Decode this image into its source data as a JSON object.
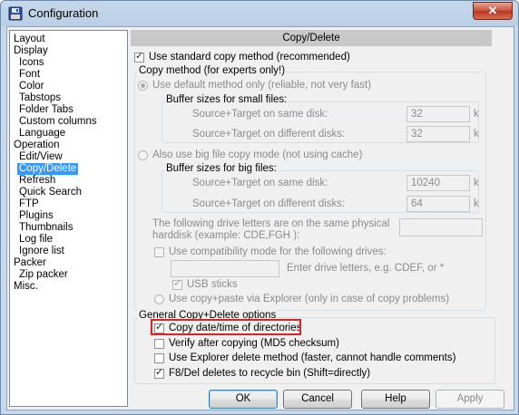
{
  "window": {
    "title": "Configuration",
    "close_glyph": "✕"
  },
  "tree": [
    {
      "label": "Layout",
      "indent": 0
    },
    {
      "label": "Display",
      "indent": 0
    },
    {
      "label": "Icons",
      "indent": 1
    },
    {
      "label": "Font",
      "indent": 1
    },
    {
      "label": "Color",
      "indent": 1
    },
    {
      "label": "Tabstops",
      "indent": 1
    },
    {
      "label": "Folder Tabs",
      "indent": 1
    },
    {
      "label": "Custom columns",
      "indent": 1
    },
    {
      "label": "Language",
      "indent": 1
    },
    {
      "label": "Operation",
      "indent": 0
    },
    {
      "label": "Edit/View",
      "indent": 1
    },
    {
      "label": "Copy/Delete",
      "indent": 1,
      "selected": true
    },
    {
      "label": "Refresh",
      "indent": 1
    },
    {
      "label": "Quick Search",
      "indent": 1
    },
    {
      "label": "FTP",
      "indent": 1
    },
    {
      "label": "Plugins",
      "indent": 1
    },
    {
      "label": "Thumbnails",
      "indent": 1
    },
    {
      "label": "Log file",
      "indent": 1
    },
    {
      "label": "Ignore list",
      "indent": 1
    },
    {
      "label": "Packer",
      "indent": 0
    },
    {
      "label": "Zip packer",
      "indent": 1
    },
    {
      "label": "Misc.",
      "indent": 0
    }
  ],
  "panel": {
    "header": "Copy/Delete",
    "use_standard": "Use standard copy method (recommended)",
    "copy_method_group": "Copy method (for experts only!)",
    "default_method": "Use default method only (reliable, not very fast)",
    "small_buffers": "Buffer sizes for small files:",
    "same_disk": "Source+Target on same disk:",
    "diff_disk": "Source+Target on different disks:",
    "small_same_value": "32",
    "small_diff_value": "32",
    "unit_k": "k",
    "big_file_mode": "Also use big file copy mode (not using cache)",
    "big_buffers": "Buffer sizes for big files:",
    "big_same_value": "10240",
    "big_diff_value": "64",
    "drive_letters_line1": "The following drive letters are on the same physical",
    "drive_letters_line2": "harddisk (example: CDE,FGH ):",
    "compat_mode": "Use compatibility mode for the following drives:",
    "enter_drives": "Enter drive letters, e.g. CDEF, or *",
    "usb_sticks": "USB sticks",
    "copy_paste_explorer": "Use copy+paste via Explorer (only in case of copy problems)",
    "general_group": "General Copy+Delete options",
    "copy_date_time": "Copy date/time of directories",
    "verify": "Verify after copying (MD5 checksum)",
    "explorer_delete": "Use Explorer delete method (faster, cannot handle comments)",
    "f8_del": "F8/Del deletes to recycle bin (Shift=directly)",
    "checkmark": "✓"
  },
  "buttons": {
    "ok": "OK",
    "cancel": "Cancel",
    "help": "Help",
    "apply": "Apply"
  },
  "colors": {
    "selection": "#3399ff",
    "highlight_box": "#e02020"
  }
}
